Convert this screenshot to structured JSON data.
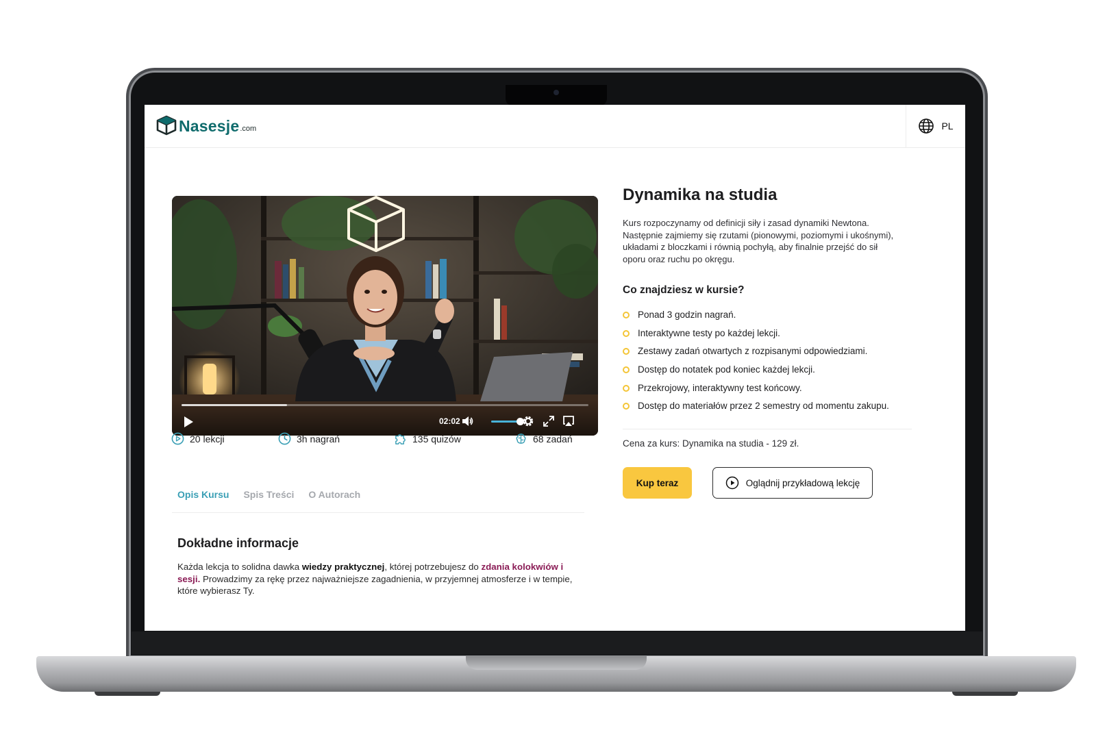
{
  "brand": {
    "name": "Nasesje",
    "suffix": ".com"
  },
  "language": {
    "code": "PL",
    "icon": "globe-icon"
  },
  "video": {
    "time": "02:02",
    "progress": 0.26,
    "volume": 0.8,
    "icons": [
      "play-icon",
      "volume-icon",
      "settings-icon",
      "fullscreen-icon",
      "airplay-icon"
    ]
  },
  "stats": [
    {
      "label": "20 lekcji",
      "icon": "play-circle-icon"
    },
    {
      "label": "3h nagrań",
      "icon": "clock-icon"
    },
    {
      "label": "135 quizów",
      "icon": "puzzle-icon"
    },
    {
      "label": "68 zadań",
      "icon": "brain-icon"
    }
  ],
  "tabs": [
    {
      "label": "Opis Kursu",
      "active": true
    },
    {
      "label": "Spis Treści",
      "active": false
    },
    {
      "label": "O Autorach",
      "active": false
    }
  ],
  "details": {
    "title": "Dokładne informacje",
    "text_1": "Każda lekcja to solidna dawka ",
    "bold_1": "wiedzy praktycznej",
    "text_2": ", której potrzebujesz do ",
    "highlight": "zdania kolokwiów i sesji.",
    "text_3": " Prowadzimy za rękę przez najważniejsze zagadnienia, w przyjemnej atmosferze i w tempie, które wybierasz Ty."
  },
  "course": {
    "title": "Dynamika na studia",
    "intro": "Kurs rozpoczynamy od definicji siły i zasad dynamiki Newtona. Następnie zajmiemy się rzutami (pionowymi, poziomymi i ukośnymi), układami z bloczkami i równią pochyłą, aby finalnie przejść do sił oporu oraz ruchu po okręgu.",
    "features_title": "Co znajdziesz w kursie?",
    "features": [
      "Ponad 3 godzin nagrań.",
      "Interaktywne testy po każdej lekcji.",
      "Zestawy zadań otwartych z rozpisanymi odpowiedziami.",
      "Dostęp do notatek pod koniec każdej lekcji.",
      "Przekrojowy, interaktywny test końcowy.",
      "Dostęp do materiałów przez 2 semestry od momentu zakupu."
    ],
    "price": "Cena za kurs: Dynamika na studia - 129 zł.",
    "buy_label": "Kup teraz",
    "sample_label": "Oglądnij przykładową lekcję"
  },
  "colors": {
    "brand": "#0f6b6c",
    "accent_tab": "#3a9fb5",
    "highlight": "#8a1b55",
    "buy_button": "#f9c73f",
    "bullet": "#f4c537"
  }
}
